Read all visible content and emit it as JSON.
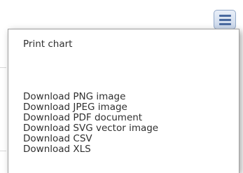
{
  "export_button": {
    "icon": "menu-icon",
    "color": "#4a6a9f"
  },
  "menu": {
    "items": [
      {
        "label": "Print chart"
      },
      {
        "label": "Download PNG image"
      },
      {
        "label": "Download JPEG image"
      },
      {
        "label": "Download PDF document"
      },
      {
        "label": "Download SVG vector image"
      },
      {
        "label": "Download CSV"
      },
      {
        "label": "Download XLS"
      }
    ]
  }
}
